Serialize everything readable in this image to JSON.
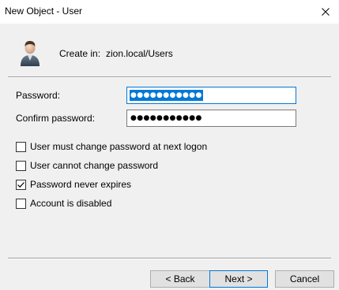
{
  "window": {
    "title": "New Object - User"
  },
  "header": {
    "create_in_label": "Create in:",
    "create_in_value": "zion.local/Users"
  },
  "form": {
    "password_label": "Password:",
    "password_value": "●●●●●●●●●●●",
    "confirm_label": "Confirm password:",
    "confirm_value": "●●●●●●●●●●●"
  },
  "options": [
    {
      "label": "User must change password at next logon",
      "checked": false
    },
    {
      "label": "User cannot change password",
      "checked": false
    },
    {
      "label": "Password never expires",
      "checked": true
    },
    {
      "label": "Account is disabled",
      "checked": false
    }
  ],
  "buttons": {
    "back": "< Back",
    "next": "Next >",
    "cancel": "Cancel"
  },
  "colors": {
    "accent": "#0078d7",
    "background": "#f0f0f0",
    "titlebar": "#ffffff"
  },
  "icons": {
    "header": "user-icon",
    "close": "close-icon"
  }
}
